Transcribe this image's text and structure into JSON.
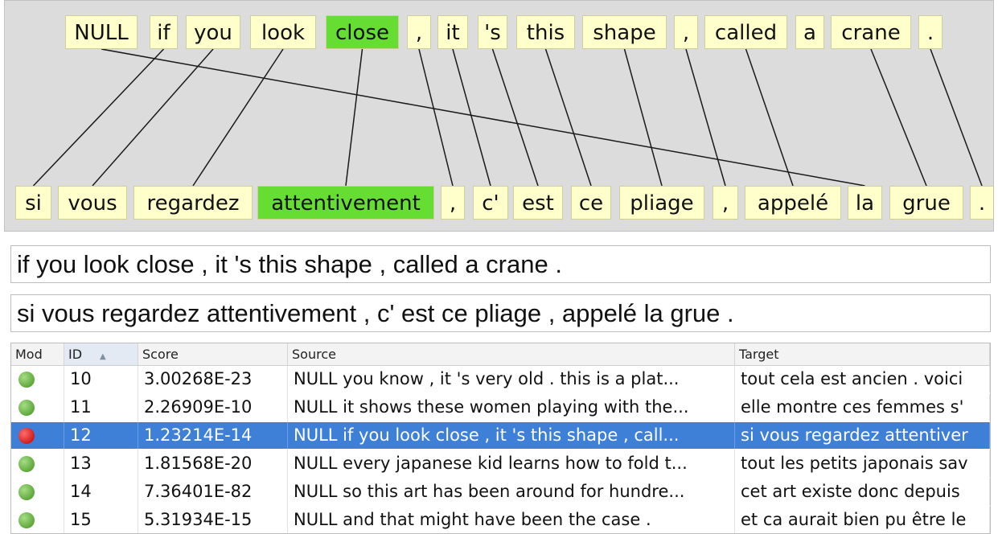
{
  "source_tokens": [
    "NULL",
    "if",
    "you",
    "look",
    "close",
    ",",
    "it",
    "'s",
    "this",
    "shape",
    ",",
    "called",
    "a",
    "crane",
    "."
  ],
  "target_tokens": [
    "si",
    "vous",
    "regardez",
    "attentivement",
    ",",
    "c'",
    "est",
    "ce",
    "pliage",
    ",",
    "appelé",
    "la",
    "grue",
    "."
  ],
  "highlight": {
    "source": 4,
    "target": 3
  },
  "alignments": [
    [
      1,
      0
    ],
    [
      2,
      1
    ],
    [
      3,
      2
    ],
    [
      4,
      3
    ],
    [
      5,
      4
    ],
    [
      6,
      5
    ],
    [
      7,
      6
    ],
    [
      8,
      7
    ],
    [
      9,
      8
    ],
    [
      10,
      9
    ],
    [
      11,
      10
    ],
    [
      0,
      11
    ],
    [
      13,
      12
    ],
    [
      14,
      13
    ]
  ],
  "source_sentence": "if you look close , it 's this shape , called a crane .",
  "target_sentence": "si vous regardez attentivement , c' est ce pliage , appelé la grue .",
  "table": {
    "columns": [
      "Mod",
      "ID",
      "Score",
      "Source",
      "Target"
    ],
    "sort_column": "ID",
    "selected_row": 2,
    "rows": [
      {
        "status": "green",
        "id": "10",
        "score": "3.00268E-23",
        "source": "NULL you know , it 's very old . this is a plat...",
        "target": "tout cela est ancien . voici"
      },
      {
        "status": "green",
        "id": "11",
        "score": "2.26909E-10",
        "source": "NULL it shows these women playing with the...",
        "target": "elle montre ces femmes s'"
      },
      {
        "status": "red",
        "id": "12",
        "score": "1.23214E-14",
        "source": "NULL if you look close , it 's this shape , call...",
        "target": "si vous regardez attentiver"
      },
      {
        "status": "green",
        "id": "13",
        "score": "1.81568E-20",
        "source": "NULL every japanese kid learns how to fold t...",
        "target": "tout les petits japonais sav"
      },
      {
        "status": "green",
        "id": "14",
        "score": "7.36401E-82",
        "source": "NULL so this art has been around for hundre...",
        "target": "cet art existe donc depuis"
      },
      {
        "status": "green",
        "id": "15",
        "score": "5.31934E-15",
        "source": "NULL and that might have been the case .",
        "target": "et ca aurait bien pu être le"
      }
    ]
  }
}
